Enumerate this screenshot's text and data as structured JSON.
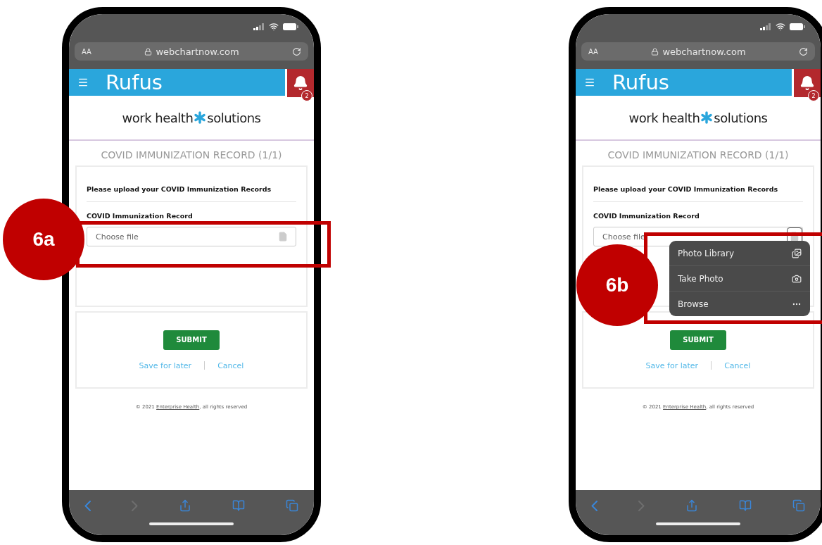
{
  "phones": [
    {
      "text_size": "AA",
      "url": "webchartnow.com",
      "app_title": "Rufus",
      "notification_count": "2",
      "logo": {
        "before": "work health",
        "after": "solutions"
      },
      "page_title": "COVID IMMUNIZATION RECORD (1/1)",
      "instructions": "Please upload your COVID Immunization Records",
      "field_label": "COVID Immunization Record",
      "file_placeholder": "Choose file",
      "submit": "SUBMIT",
      "links": [
        "Save for later",
        "Cancel"
      ],
      "footer": {
        "prefix": "© 2021 ",
        "link": "Enterprise Health",
        "suffix": ", all rights reserved"
      },
      "toolbar": [
        {
          "kind": "back",
          "disabled": false
        },
        {
          "kind": "forward",
          "disabled": true
        },
        {
          "kind": "share",
          "disabled": false
        },
        {
          "kind": "bookmarks",
          "disabled": false
        },
        {
          "kind": "tabs",
          "disabled": false
        }
      ],
      "callout": "6a"
    },
    {
      "text_size": "AA",
      "url": "webchartnow.com",
      "app_title": "Rufus",
      "notification_count": "2",
      "logo": {
        "before": "work health",
        "after": "solutions"
      },
      "page_title": "COVID IMMUNIZATION RECORD (1/1)",
      "instructions": "Please upload your COVID Immunization Records",
      "field_label": "COVID Immunization Record",
      "file_placeholder": "Choose file",
      "menu": [
        {
          "label": "Photo Library",
          "kind": "photos"
        },
        {
          "label": "Take Photo",
          "kind": "camera"
        },
        {
          "label": "Browse",
          "kind": "more"
        }
      ],
      "submit": "SUBMIT",
      "links": [
        "Save for later",
        "Cancel"
      ],
      "footer": {
        "prefix": "© 2021 ",
        "link": "Enterprise Health",
        "suffix": ", all rights reserved"
      },
      "toolbar": [
        {
          "kind": "back",
          "disabled": false
        },
        {
          "kind": "forward",
          "disabled": true
        },
        {
          "kind": "share",
          "disabled": false
        },
        {
          "kind": "bookmarks",
          "disabled": false
        },
        {
          "kind": "tabs",
          "disabled": false
        }
      ],
      "callout": "6b"
    }
  ]
}
